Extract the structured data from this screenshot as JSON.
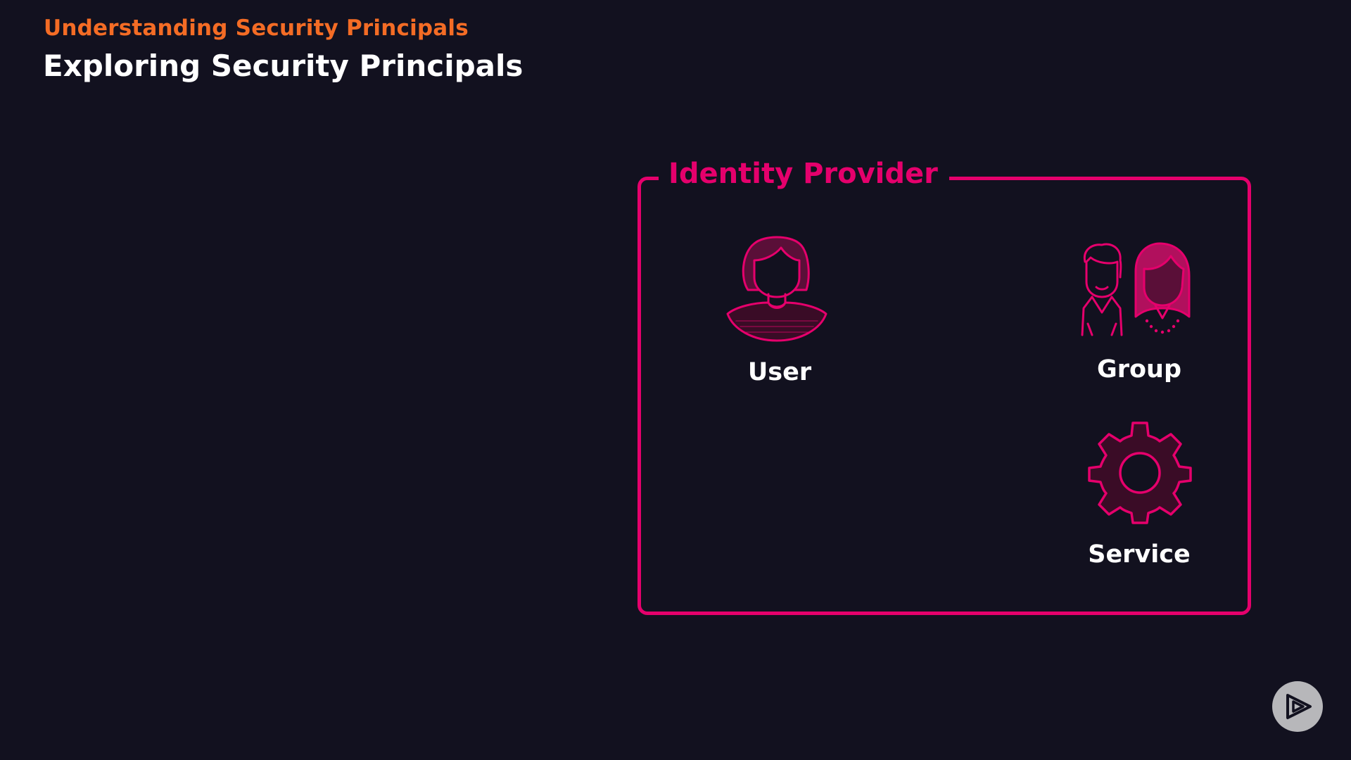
{
  "header": {
    "subtitle": "Understanding Security Principals",
    "title": "Exploring Security Principals"
  },
  "diagram": {
    "container_label": "Identity Provider",
    "principals": [
      {
        "label": "User",
        "icon": "user-icon"
      },
      {
        "label": "Group",
        "icon": "group-icon"
      },
      {
        "label": "Service",
        "icon": "gear-icon"
      }
    ]
  },
  "branding": {
    "logo_icon": "play-logo-icon"
  },
  "colors": {
    "background": "#12111f",
    "accent_orange": "#f46c25",
    "accent_pink": "#e5006c",
    "text_white": "#ffffff",
    "logo_gray": "#b7b7ba"
  }
}
